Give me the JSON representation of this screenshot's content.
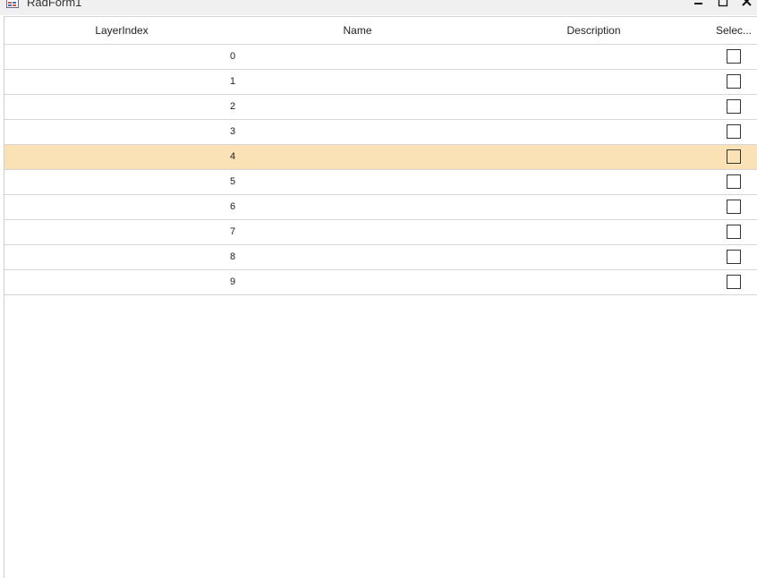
{
  "window": {
    "title": "RadForm1",
    "icon": "app-form-icon",
    "controls": [
      "minimize-icon",
      "maximize-icon",
      "close-icon"
    ]
  },
  "grid": {
    "columns": [
      "LayerIndex",
      "Name",
      "Description",
      "Selec..."
    ],
    "rows": [
      {
        "layer_index": "0",
        "name": "",
        "description": "",
        "selected": false
      },
      {
        "layer_index": "1",
        "name": "",
        "description": "",
        "selected": false
      },
      {
        "layer_index": "2",
        "name": "",
        "description": "",
        "selected": false
      },
      {
        "layer_index": "3",
        "name": "",
        "description": "",
        "selected": false
      },
      {
        "layer_index": "4",
        "name": "",
        "description": "",
        "selected": false
      },
      {
        "layer_index": "5",
        "name": "",
        "description": "",
        "selected": false
      },
      {
        "layer_index": "6",
        "name": "",
        "description": "",
        "selected": false
      },
      {
        "layer_index": "7",
        "name": "",
        "description": "",
        "selected": false
      },
      {
        "layer_index": "8",
        "name": "",
        "description": "",
        "selected": false
      },
      {
        "layer_index": "9",
        "name": "",
        "description": "",
        "selected": false
      }
    ],
    "current_row": 4
  },
  "colors": {
    "selected_row": "#fae1b6",
    "grid_line": "#d6d6d6",
    "titlebar": "#f0f0f0"
  }
}
